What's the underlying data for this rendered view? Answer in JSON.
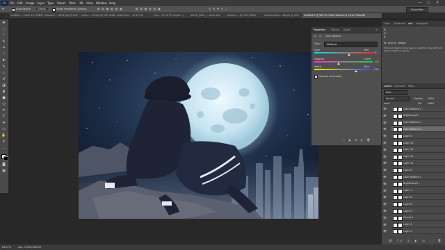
{
  "app": {
    "logo": "Ps",
    "menu": [
      "File",
      "Edit",
      "Image",
      "Layer",
      "Type",
      "Select",
      "Filter",
      "3D",
      "View",
      "Window",
      "Help"
    ],
    "window_controls": [
      "—",
      "□",
      "✕"
    ]
  },
  "options": {
    "auto_select_label": "Auto-Select:",
    "auto_select_value": "Group",
    "transform_label": "Show Transform Controls",
    "workspace": "Essentials"
  },
  "tabs": [
    "Untitled-... Layer 14, RGB/8#",
    "Stardust-... 3092.jpg @ 33%",
    "moon-... 16.jpg @ 33% (RGB)",
    "wireframe-... @ 33.3%",
    "city-... @ 16.7% (Layer...)",
    "gothic_lolita_... stock.psd",
    "woman-... @ 33% (RGB)",
    "pexels-photo-...68.jpg @ 33%",
    "Untitled-1 @ 66.7% (Color Balance 4, Layer Mask/8)"
  ],
  "properties": {
    "tabs": [
      "Properties",
      "History",
      "Styles"
    ],
    "title": "Color Balance",
    "tone_label": "Tone:",
    "tone_value": "Midtones",
    "sliders": [
      {
        "left": "Cyan",
        "right": "Red",
        "value": "+17",
        "fraction": 0.6,
        "gradient": [
          "#00e5ff",
          "#ff2a2a"
        ]
      },
      {
        "left": "Magenta",
        "right": "Green",
        "value": "-16",
        "fraction": 0.42,
        "gradient": [
          "#ff2bd4",
          "#27d23c"
        ]
      },
      {
        "left": "Yellow",
        "right": "Blue",
        "value": "+38",
        "fraction": 0.72,
        "gradient": [
          "#ffe500",
          "#2b4bff"
        ]
      }
    ],
    "preserve_label": "Preserve Luminosity"
  },
  "right_tabs_top": [
    "Color",
    "Swatches",
    "Info",
    "Navigator"
  ],
  "info": {
    "line1": "R:",
    "line2": "G:",
    "line3": "B:",
    "size": "W: 1920 H: 1080px",
    "hint": "Click and drag to move layer or selection. Use Shift and Alt for additional options."
  },
  "layers_panel": {
    "tabs": [
      "Layers",
      "Channels",
      "Paths"
    ],
    "kind": "Kind",
    "blend": "Normal",
    "opacity_label": "Opacity:",
    "opacity": "100%",
    "fill_label": "Fill:",
    "fill": "100%",
    "lock_label": "Lock:",
    "rows": [
      "Color Balance 2",
      "Brightness/C...",
      "Color Balance 1",
      "Color Balance 4",
      "Layer 5",
      "Layer 13",
      "Layer 10",
      "Layer 12",
      "Layer 11",
      "Layer 6",
      "Color Balance 3",
      "Brightness/C...",
      "Layer 7",
      "Layer 8",
      "Layer 9",
      "Layer 3",
      "Curves 1",
      "Layer 2",
      "Layer 1"
    ],
    "selected_index": 3
  },
  "status": {
    "zoom": "66.67%",
    "doc": "Doc: 5.93M/186.0M"
  }
}
